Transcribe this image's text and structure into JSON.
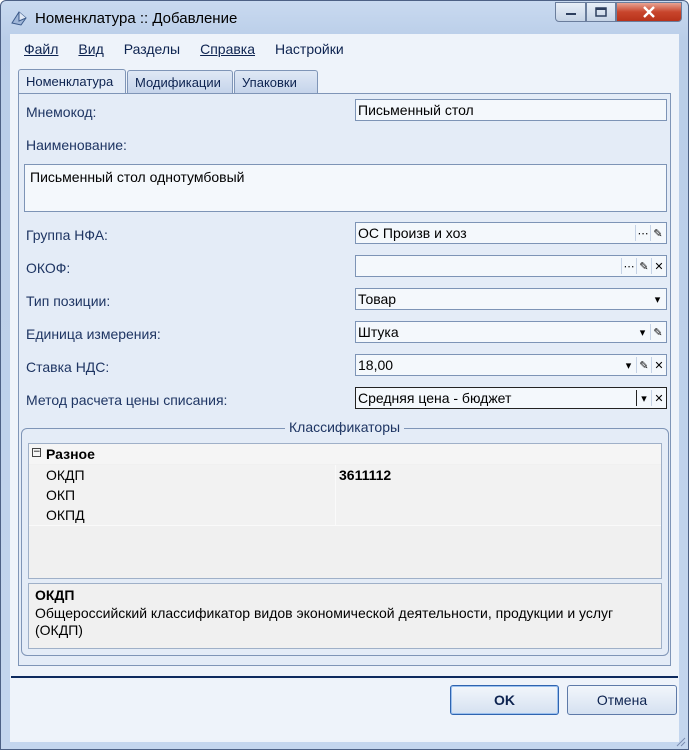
{
  "window": {
    "title": "Номенклатура :: Добавление"
  },
  "menu": [
    "Файл",
    "Вид",
    "Разделы",
    "Справка",
    "Настройки"
  ],
  "tabs": [
    "Номенклатура",
    "Модификации",
    "Упаковки"
  ],
  "form": {
    "mnemocode_label": "Мнемокод:",
    "mnemocode_value": "Письменный стол",
    "name_label": "Наименование:",
    "name_value": "Письменный стол однотумбовый",
    "group_label": "Группа НФА:",
    "group_value": "ОС Произв и хоз",
    "okof_label": "ОКОФ:",
    "okof_value": "",
    "position_type_label": "Тип позиции:",
    "position_type_value": "Товар",
    "unit_label": "Единица измерения:",
    "unit_value": "Штука",
    "vat_label": "Ставка НДС:",
    "vat_value": "18,00",
    "method_label": "Метод расчета цены списания:",
    "method_value": "Средняя цена - бюджет"
  },
  "classifiers": {
    "title": "Классификаторы",
    "category": "Разное",
    "rows": [
      {
        "name": "ОКДП",
        "value": "3611112"
      },
      {
        "name": "ОКП",
        "value": ""
      },
      {
        "name": "ОКПД",
        "value": ""
      }
    ],
    "desc_title": "ОКДП",
    "desc_text": "Общероссийский классификатор видов экономической деятельности, продукции и услуг (ОКДП)"
  },
  "buttons": {
    "ok": "OK",
    "cancel": "Отмена"
  },
  "icons": {
    "title": "app-icon",
    "ellipsis": "ellipsis-icon",
    "edit": "pencil-icon",
    "clear": "clear-x-icon",
    "dropdown": "dropdown-arrow-icon"
  },
  "colors": {
    "accent": "#0d2a5e",
    "close_button": "#c8452c"
  }
}
